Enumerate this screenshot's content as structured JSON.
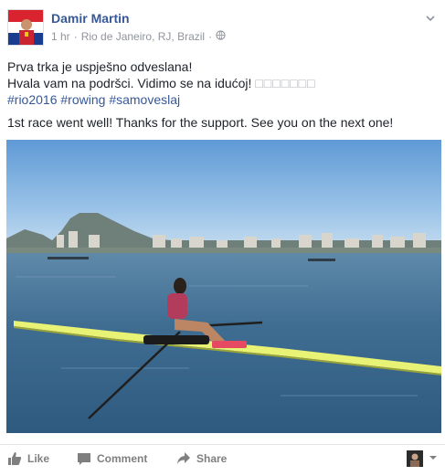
{
  "post": {
    "author": "Damir Martin",
    "time": "1 hr",
    "location": "Rio de Janeiro, RJ, Brazil",
    "separator": "·",
    "privacy_icon": "globe-icon",
    "text": {
      "line1": "Prva trka je uspješno odveslana!",
      "line2_text": "Hvala vam na podršci. Vidimo se na idućoj! ",
      "line2_emoji": "□□□□□□□",
      "hashtags": [
        "#rio2016",
        "#rowing",
        "#samoveslaj"
      ],
      "english": "1st race went well! Thanks for the support. See you on the next one!"
    }
  },
  "actions": {
    "like": "Like",
    "comment": "Comment",
    "share": "Share"
  },
  "colors": {
    "link": "#365899",
    "meta": "#90949c",
    "action": "#7f7f7f"
  }
}
